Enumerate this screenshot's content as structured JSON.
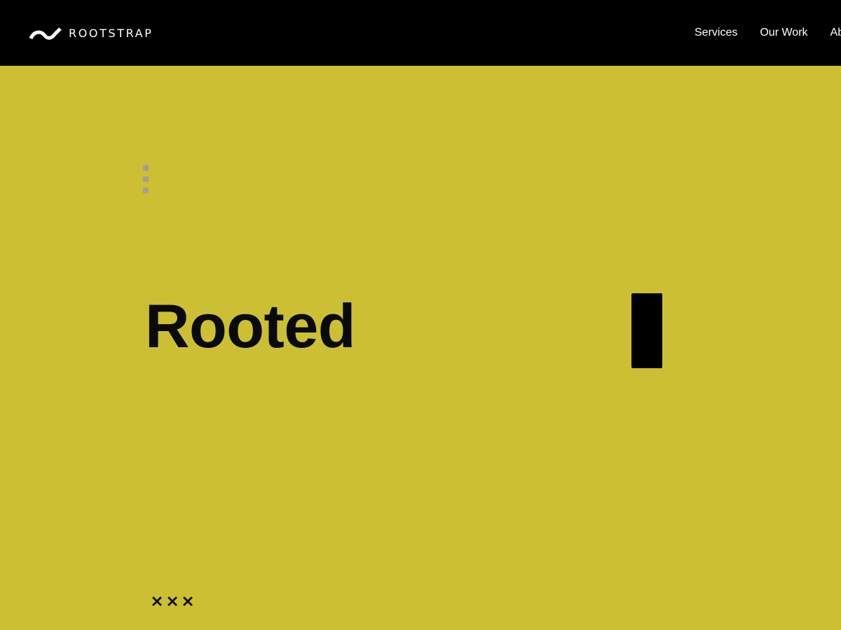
{
  "header": {
    "logo_text": "ROOTSTRAP",
    "logo_icon": "rootstrap-wave-check-icon",
    "nav": [
      {
        "label": "Services"
      },
      {
        "label": "Our Work"
      },
      {
        "label": "About"
      }
    ]
  },
  "hero": {
    "headline": "Rooted",
    "background_color": "#ccbf33",
    "decorative_icons": [
      "vertical-dots-icon",
      "text-cursor-block-icon",
      "cross-marks-icon"
    ]
  },
  "colors": {
    "nav_background": "#000000",
    "nav_text": "#ffffff",
    "hero_background": "#ccbf33",
    "headline_text": "#0a0a0a",
    "dots": "#a29f9a"
  }
}
